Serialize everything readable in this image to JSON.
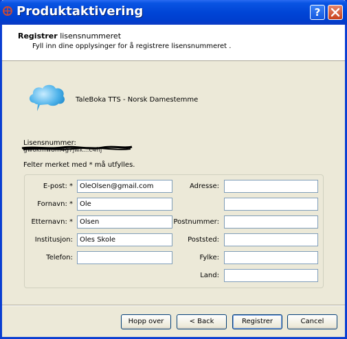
{
  "window": {
    "title": "Produktaktivering",
    "help_label": "?",
    "close_label": "✕",
    "icon": "app-icon"
  },
  "header": {
    "title_bold": "Registrer",
    "title_rest": " lisensnummeret",
    "subtitle": "Fyll inn dine opplysinger for å registrere lisensnummeret ."
  },
  "product": {
    "name": "TaleBoka TTS - Norsk Damestemme",
    "icon": "speech-cloud-icon"
  },
  "license": {
    "label": "Lisensnummer:",
    "value": "gw6kmw8m4g7jwk...c4hj"
  },
  "required_note": "Felter merket med * må utfylles.",
  "form": {
    "left": [
      {
        "label": "E-post: *",
        "value": "OleOlsen@gmail.com"
      },
      {
        "label": "Fornavn: *",
        "value": "Ole"
      },
      {
        "label": "Etternavn: *",
        "value": "Olsen"
      },
      {
        "label": "Institusjon:",
        "value": "Oles Skole"
      },
      {
        "label": "Telefon:",
        "value": ""
      }
    ],
    "right": [
      {
        "label": "Adresse:",
        "value": ""
      },
      {
        "label": "",
        "value": ""
      },
      {
        "label": "Postnummer:",
        "value": ""
      },
      {
        "label": "Poststed:",
        "value": ""
      },
      {
        "label": "Fylke:",
        "value": ""
      },
      {
        "label": "Land:",
        "value": ""
      }
    ]
  },
  "buttons": {
    "skip": "Hopp over",
    "back": "< Back",
    "register": "Registrer",
    "cancel": "Cancel"
  }
}
